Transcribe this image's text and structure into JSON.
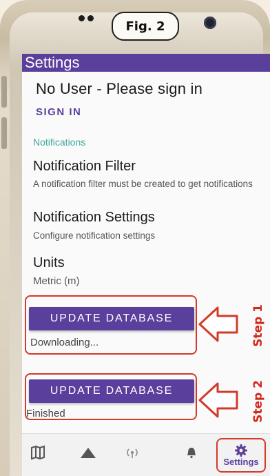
{
  "figure_label": "Fig. 2",
  "app_bar": {
    "title": "Settings"
  },
  "account": {
    "title": "No User - Please sign in",
    "sign_in_label": "SIGN IN"
  },
  "notifications": {
    "header": "Notifications",
    "filter_title": "Notification Filter",
    "filter_summary": "A notification filter must be created to get notifications",
    "settings_title": "Notification Settings",
    "settings_summary": "Configure notification settings"
  },
  "units": {
    "title": "Units",
    "value": "Metric (m)"
  },
  "step1": {
    "button_label": "UPDATE DATABASE",
    "status": "Downloading...",
    "callout": "Step 1"
  },
  "step2": {
    "button_label": "UPDATE DATABASE",
    "status": "Finished",
    "callout": "Step 2"
  },
  "bottom_nav": {
    "items": [
      {
        "icon": "map-icon"
      },
      {
        "icon": "peak-icon"
      },
      {
        "icon": "broadcast-icon"
      },
      {
        "icon": "bell-icon"
      },
      {
        "icon": "gear-icon",
        "label": "Settings"
      }
    ]
  },
  "colors": {
    "accent": "#5b3f9c",
    "section_header": "#3fa8a0",
    "annotation": "#d23a2a"
  }
}
